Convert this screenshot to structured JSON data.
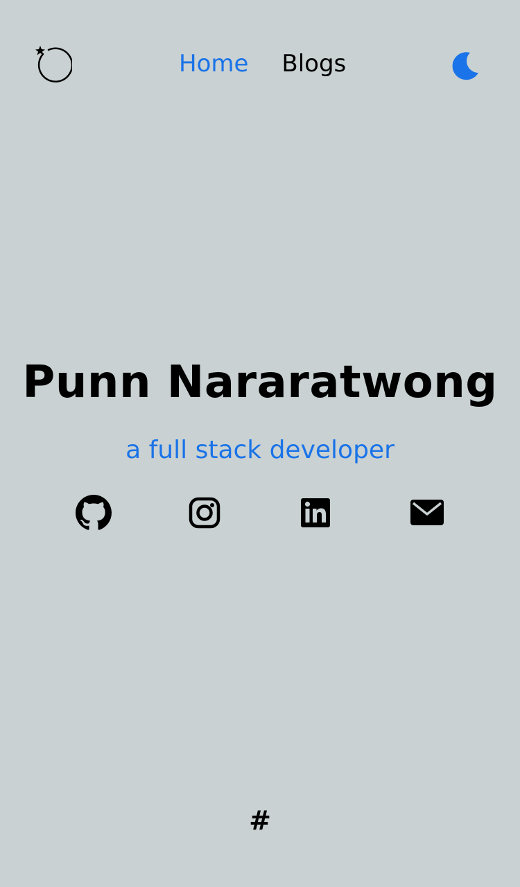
{
  "header": {
    "logo_icon": "circle-arrow-star-logo-icon",
    "nav": [
      {
        "label": "Home",
        "active": true
      },
      {
        "label": "Blogs",
        "active": false
      }
    ],
    "theme_toggle_icon": "moon-icon"
  },
  "hero": {
    "title": "Punn Nararatwong",
    "subtitle": "a full stack developer"
  },
  "social_links": [
    {
      "icon": "github-icon"
    },
    {
      "icon": "instagram-icon"
    },
    {
      "icon": "linkedin-icon"
    },
    {
      "icon": "email-icon"
    }
  ],
  "footer": {
    "mark": "#"
  },
  "colors": {
    "background": "#c9d1d2",
    "accent": "#1a73e8",
    "text": "#000000"
  }
}
